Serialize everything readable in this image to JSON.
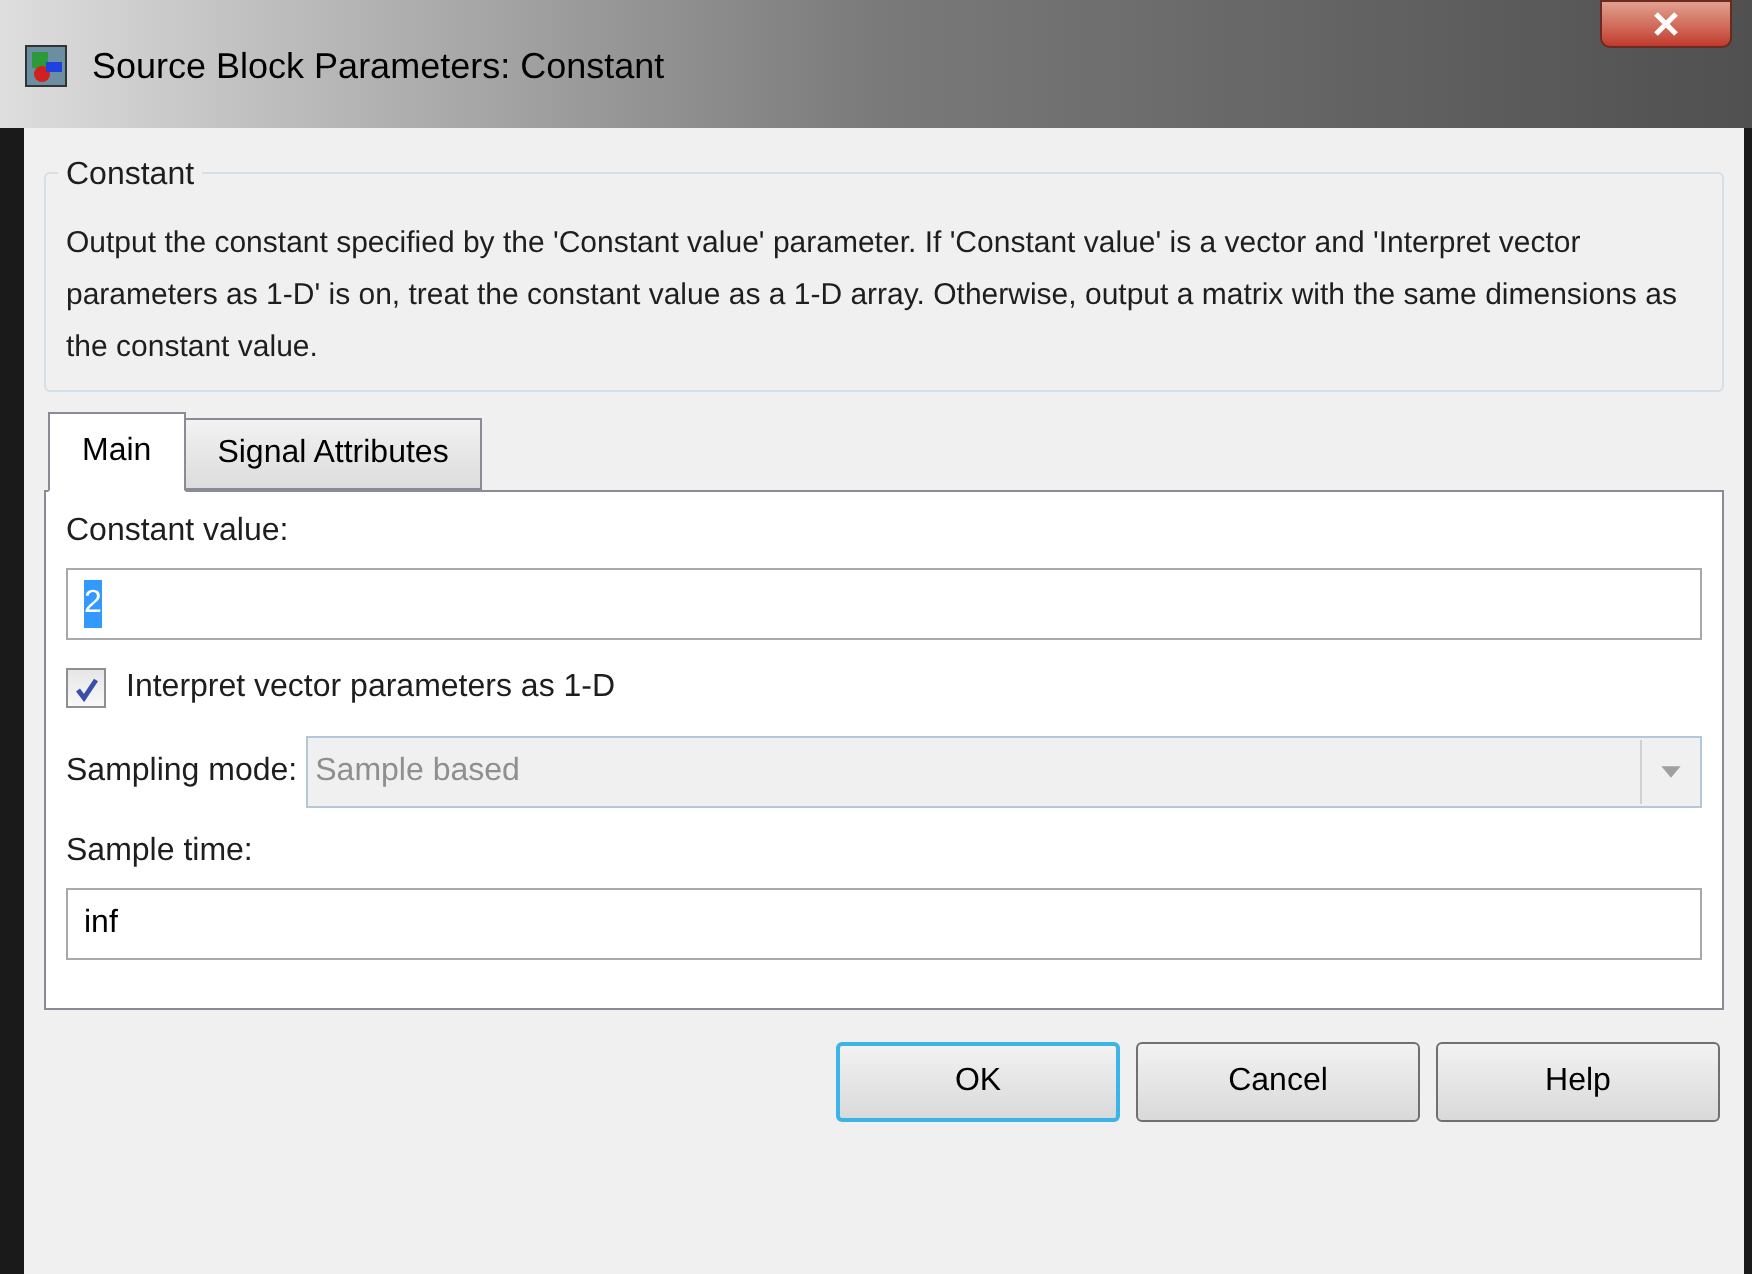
{
  "window": {
    "title": "Source Block Parameters: Constant"
  },
  "group": {
    "title": "Constant",
    "description": "Output the constant specified by the 'Constant value' parameter. If 'Constant value' is a vector and 'Interpret vector parameters as 1-D' is on, treat the constant value as a 1-D array. Otherwise, output a matrix with the same dimensions as the constant value."
  },
  "tabs": [
    {
      "label": "Main",
      "selected": true
    },
    {
      "label": "Signal Attributes",
      "selected": false
    }
  ],
  "fields": [
    {
      "kind": "text",
      "label": "Constant value:",
      "value": "2",
      "value_selected": true
    },
    {
      "kind": "checkbox",
      "label": "Interpret vector parameters as 1-D",
      "checked": true
    },
    {
      "kind": "dropdown",
      "label": "Sampling mode:",
      "value": "Sample based",
      "disabled": true
    },
    {
      "kind": "text",
      "label": "Sample time:",
      "value": "inf",
      "value_selected": false
    }
  ],
  "buttons": [
    {
      "label": "OK",
      "default": true
    },
    {
      "label": "Cancel",
      "default": false
    },
    {
      "label": "Help",
      "default": false
    }
  ]
}
